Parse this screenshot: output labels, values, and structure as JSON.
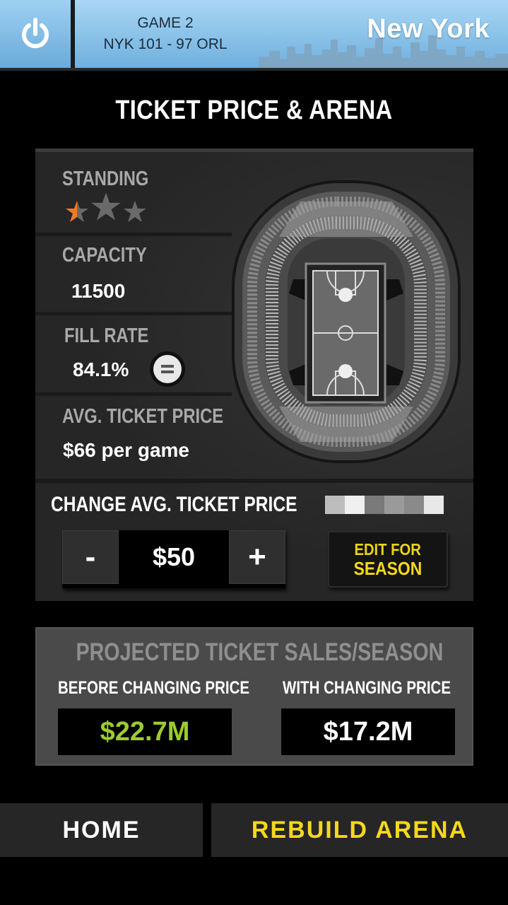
{
  "header": {
    "power_icon": "power-icon",
    "game_label": "GAME 2",
    "score_line": "NYK 101 - 97 ORL",
    "city": "New York"
  },
  "page_title": "TICKET PRICE & ARENA",
  "stats": {
    "standing": {
      "label": "STANDING",
      "stars_total": 3,
      "stars_filled": 0.5
    },
    "capacity": {
      "label": "CAPACITY",
      "value": "11500"
    },
    "fill_rate": {
      "label": "FILL RATE",
      "value": "84.1%",
      "trend_icon": "equal-icon"
    },
    "avg_ticket_price": {
      "label": "AVG. TICKET PRICE",
      "value": "$66 per game"
    }
  },
  "change_price": {
    "label": "CHANGE  AVG. TICKET  PRICE",
    "minus_label": "-",
    "plus_label": "+",
    "value": "$50",
    "edit_line1": "EDIT FOR",
    "edit_line2": "SEASON"
  },
  "projected_sales": {
    "title": "PROJECTED TICKET SALES/SEASON",
    "before_label": "BEFORE CHANGING PRICE",
    "before_value": "$22.7M",
    "after_label": "WITH CHANGING PRICE",
    "after_value": "$17.2M"
  },
  "nav": {
    "home_label": "HOME",
    "rebuild_label": "REBUILD ARENA"
  },
  "colors": {
    "accent_yellow": "#f4d81c",
    "green_value": "#9ccc2e",
    "star_orange": "#f07a28",
    "sky_blue": "#8cc6ec"
  }
}
